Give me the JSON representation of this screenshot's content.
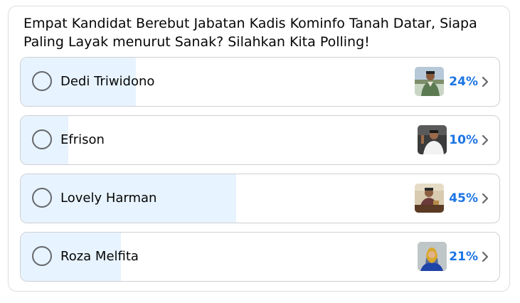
{
  "poll": {
    "question": "Empat Kandidat Berebut Jabatan Kadis Kominfo Tanah Datar, Siapa Paling Layak menurut Sanak? Silahkan Kita Polling!",
    "options": [
      {
        "label": "Dedi Triwidono",
        "percent": "24%",
        "share": 0.24
      },
      {
        "label": "Efrison",
        "percent": "10%",
        "share": 0.1
      },
      {
        "label": "Lovely Harman",
        "percent": "45%",
        "share": 0.45
      },
      {
        "label": "Roza Melfita",
        "percent": "21%",
        "share": 0.21
      }
    ]
  },
  "colors": {
    "fill": "#e7f3ff",
    "percent": "#1b74e4",
    "border": "#ced0d4",
    "radio": "#65676b"
  }
}
